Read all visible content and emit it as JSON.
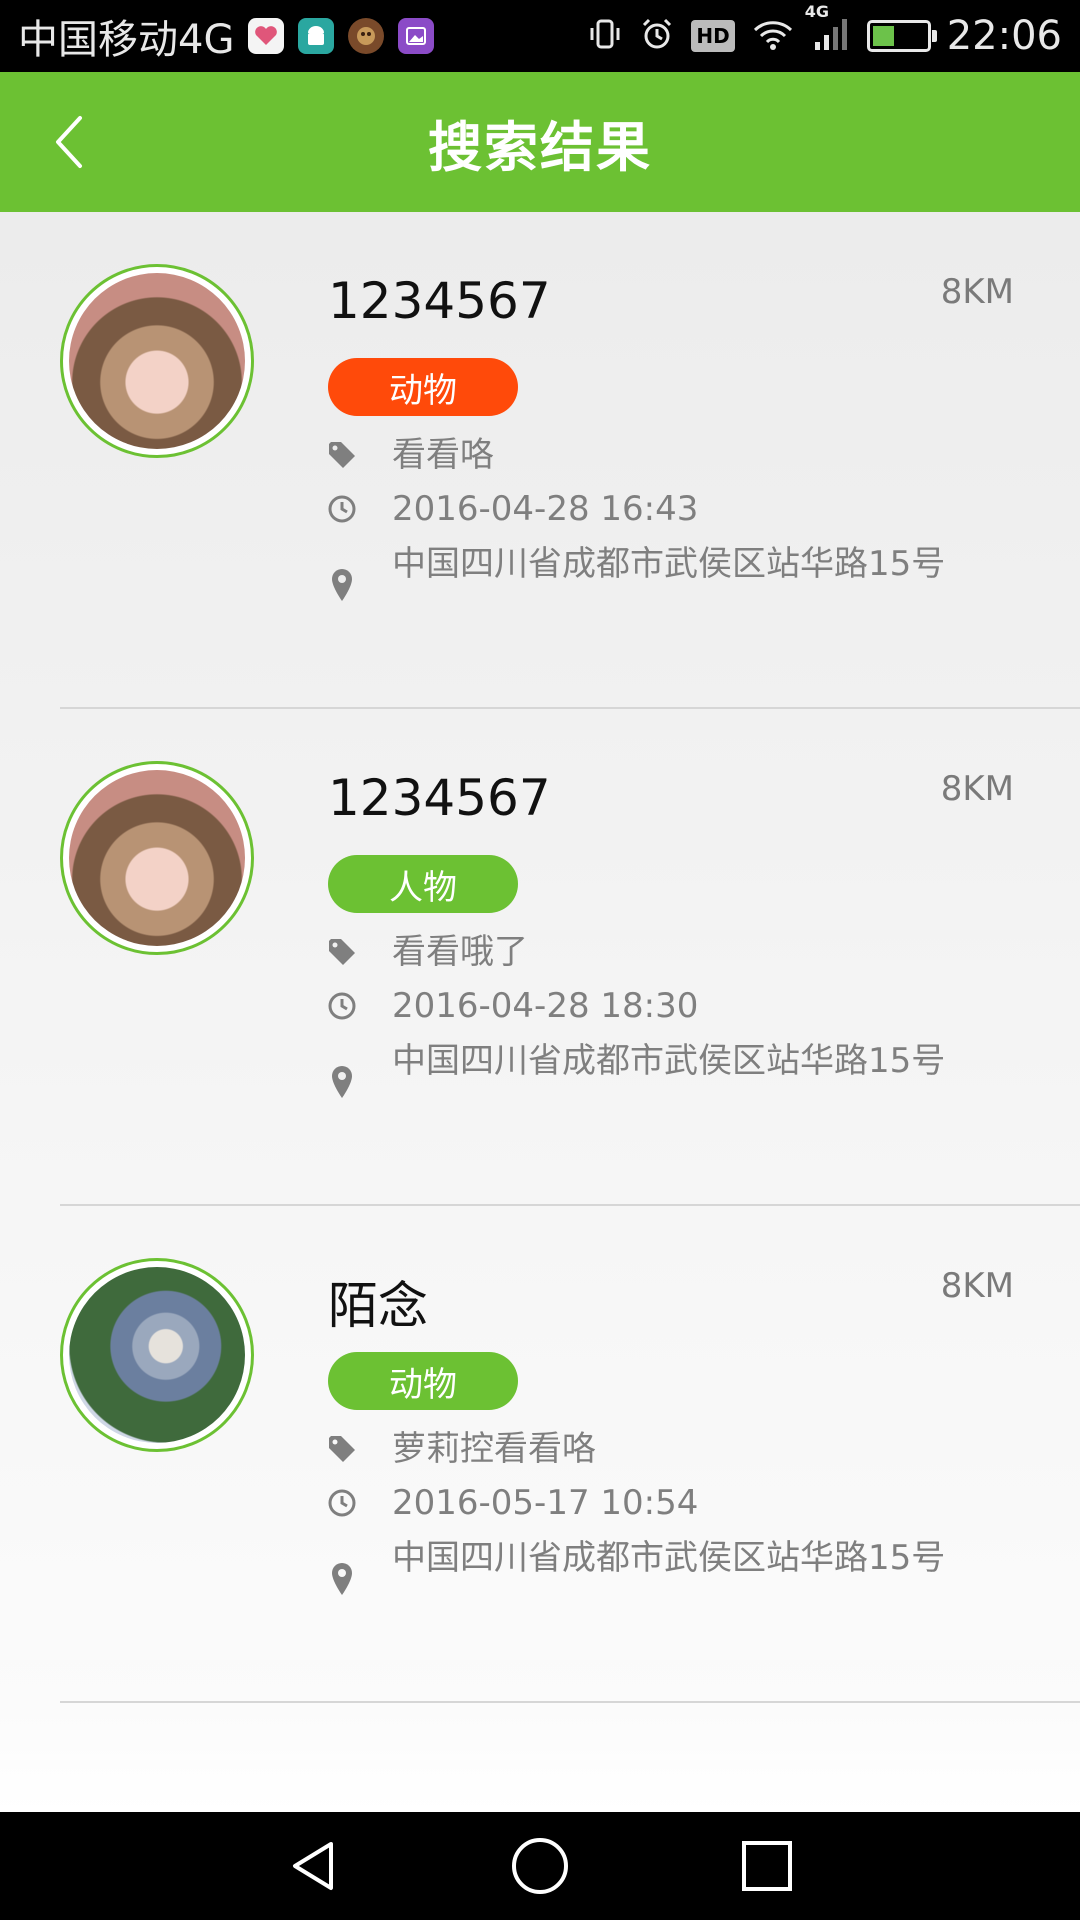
{
  "status_bar": {
    "carrier": "中国移动4G",
    "network_type": "4G",
    "hd_label": "HD",
    "time": "22:06",
    "battery_level": 0.4,
    "notification_icons": [
      "health-app-icon",
      "android-app-icon",
      "game-app-icon",
      "gallery-app-icon"
    ]
  },
  "header": {
    "title": "搜索结果",
    "back_icon": "chevron-left-icon"
  },
  "colors": {
    "accent": "#6cc133",
    "tag_orange": "#ff4a0a",
    "tag_green": "#6cc133",
    "secondary_text": "#7f7f7f"
  },
  "results": [
    {
      "name": "1234567",
      "distance": "8KM",
      "tag": "动物",
      "tag_color": "#ff4a0a",
      "note": "看看咯",
      "time": "2016-04-28 16:43",
      "address": "中国四川省成都市武侯区站华路15号"
    },
    {
      "name": "1234567",
      "distance": "8KM",
      "tag": "人物",
      "tag_color": "#6cc133",
      "note": "看看哦了",
      "time": "2016-04-28 18:30",
      "address": "中国四川省成都市武侯区站华路15号"
    },
    {
      "name": "陌念",
      "distance": "8KM",
      "tag": "动物",
      "tag_color": "#6cc133",
      "note": "萝莉控看看咯",
      "time": "2016-05-17 10:54",
      "address": "中国四川省成都市武侯区站华路15号"
    }
  ],
  "nav_bar": {
    "icons": [
      "back-triangle-icon",
      "home-circle-icon",
      "recents-square-icon"
    ]
  }
}
